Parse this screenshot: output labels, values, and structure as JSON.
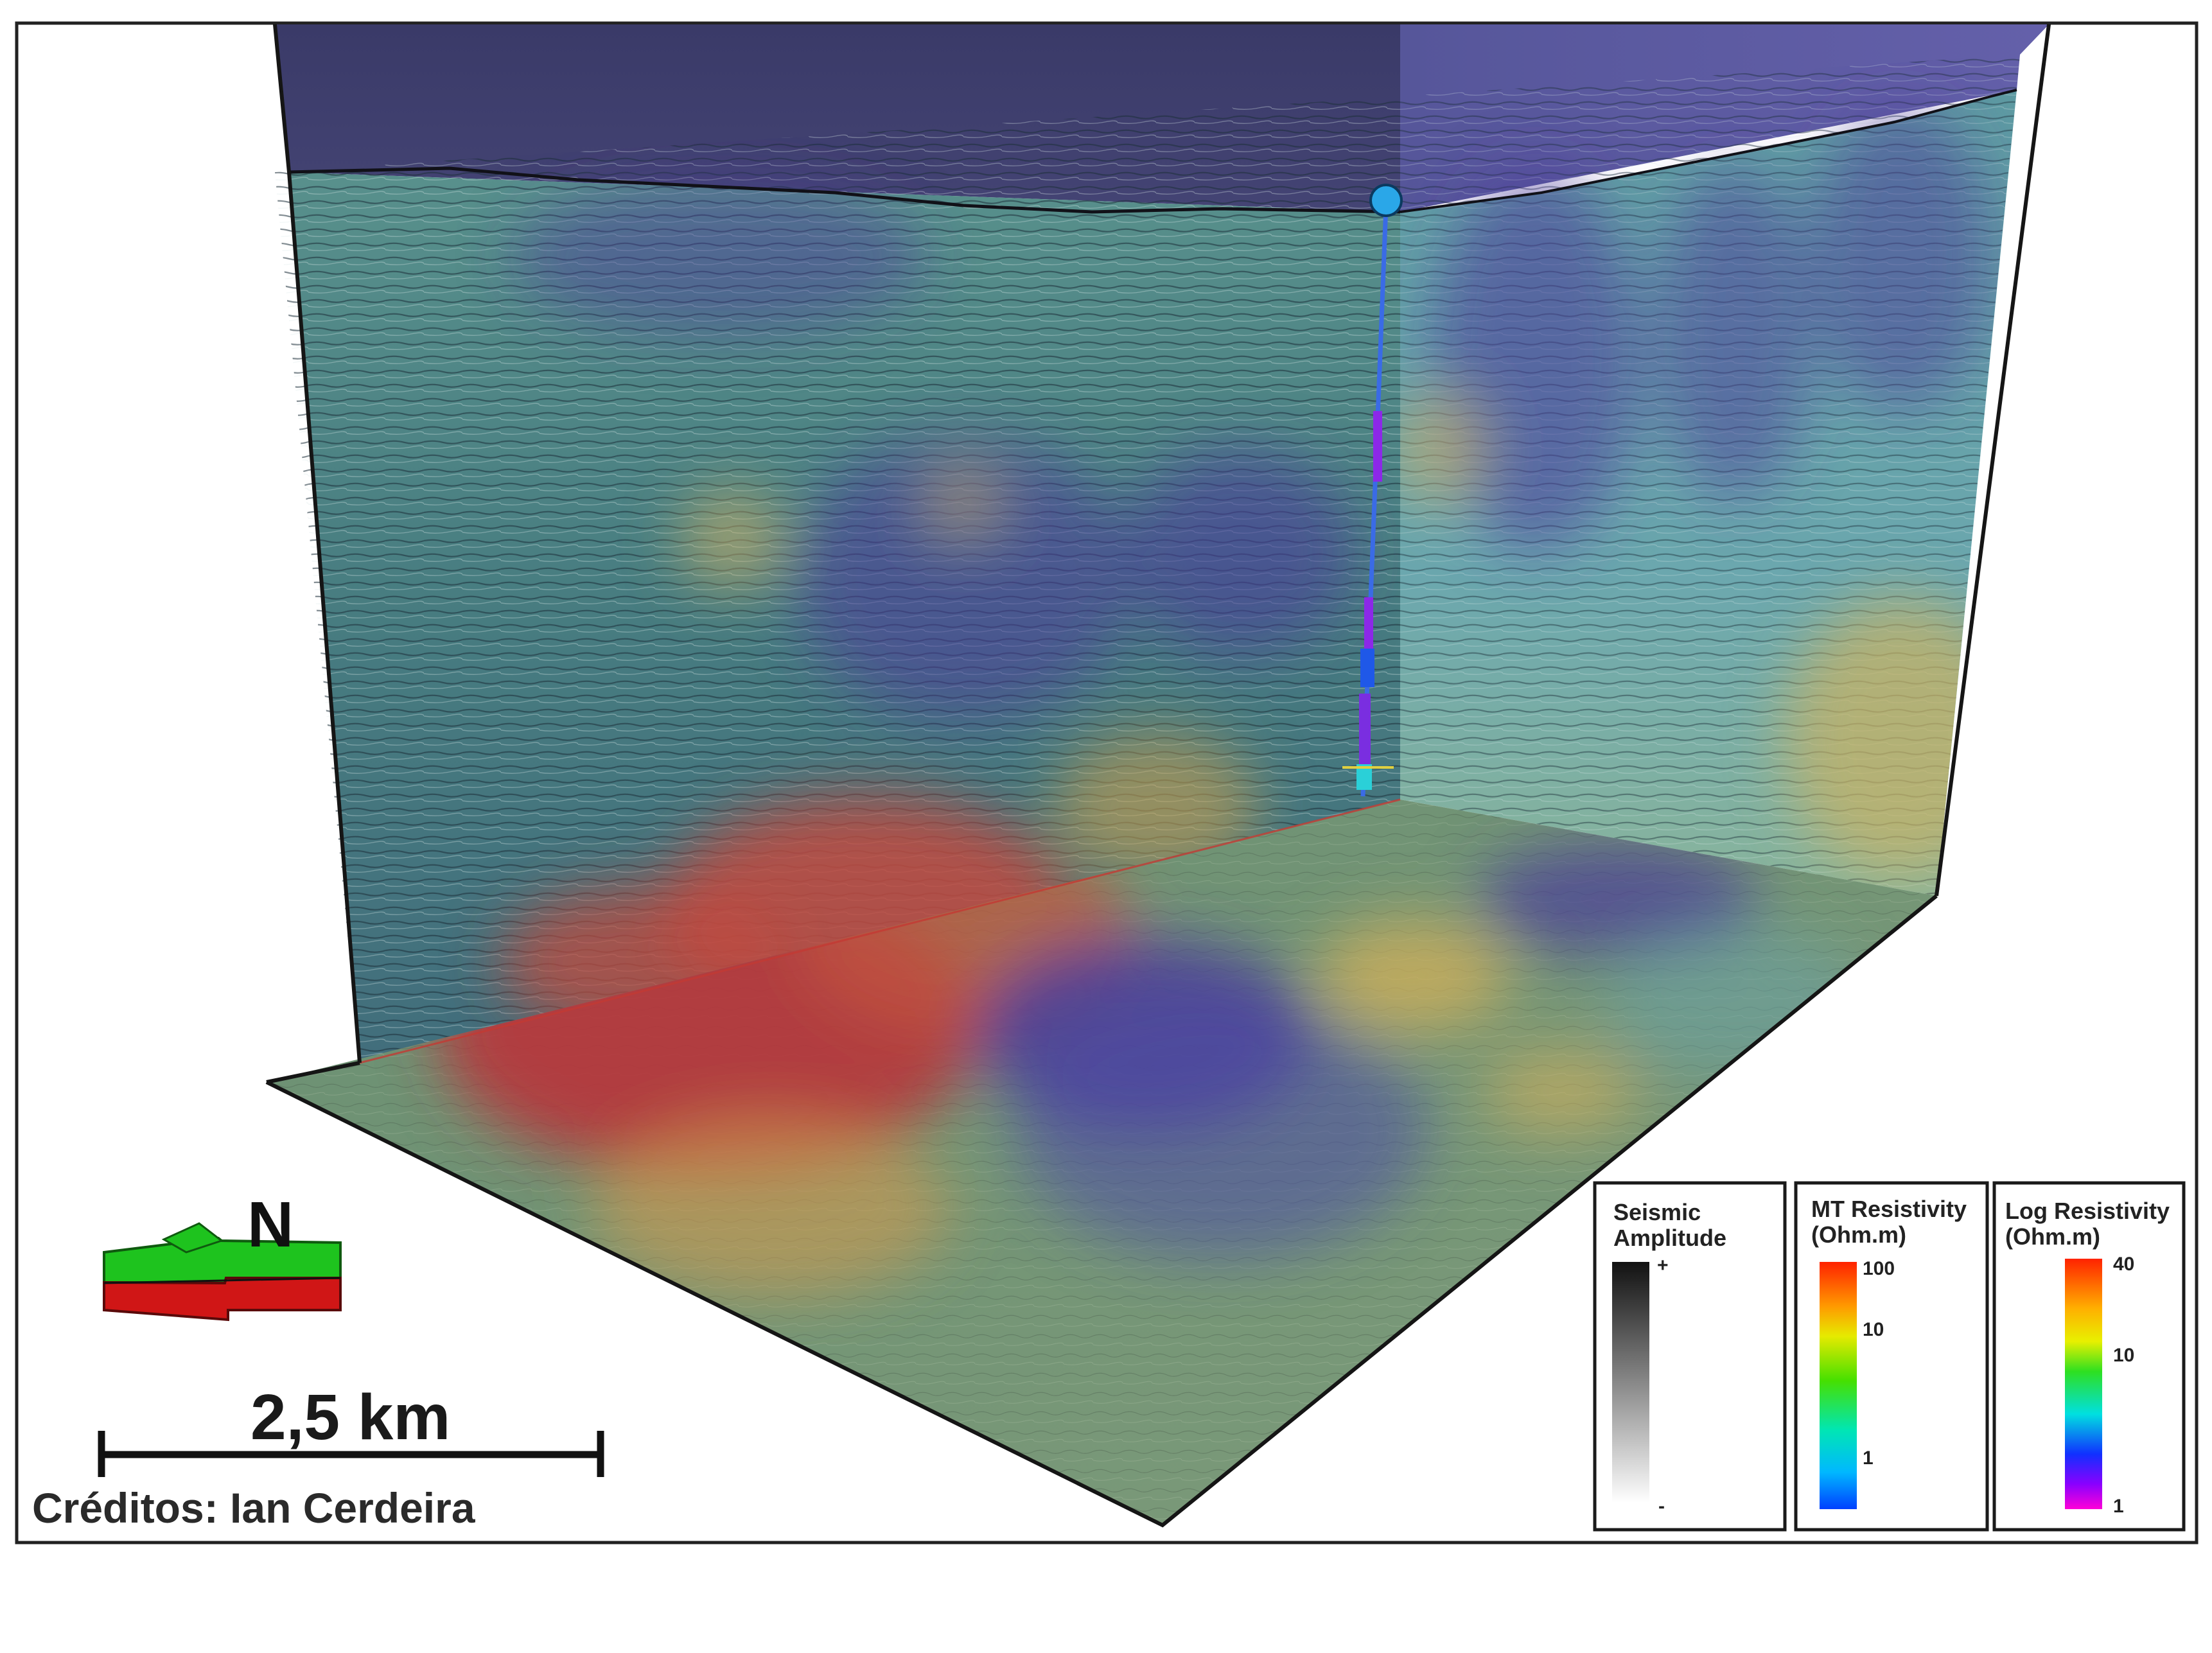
{
  "compass": {
    "north_label": "N",
    "top_color": "#1ec31e",
    "bottom_color": "#d01616"
  },
  "scale_bar": {
    "label": "2,5 km"
  },
  "credits": "Créditos: Ian Cerdeira",
  "colors": {
    "sky": "#3f3f6e",
    "sky_right": "#5a58a0",
    "seismic_base": "#4e8584",
    "low_resistivity": "#4b3c9a",
    "high_resistivity": "#c0413a",
    "mid_resistivity": "#c7b056",
    "well_marker": "#2aa7e8"
  },
  "legends": [
    {
      "title_line1": "Seismic",
      "title_line2": "Amplitude",
      "max_label": "+",
      "min_label": "-",
      "colormap": "gray"
    },
    {
      "title_line1": "MT Resistivity",
      "title_line2": "(Ohm.m)",
      "ticks": [
        "100",
        "10",
        "1"
      ],
      "colormap": "jet"
    },
    {
      "title_line1": "Log Resistivity",
      "title_line2": "(Ohm.m)",
      "ticks": [
        "40",
        "10",
        "1"
      ],
      "colormap": "rainbow-magenta"
    }
  ]
}
